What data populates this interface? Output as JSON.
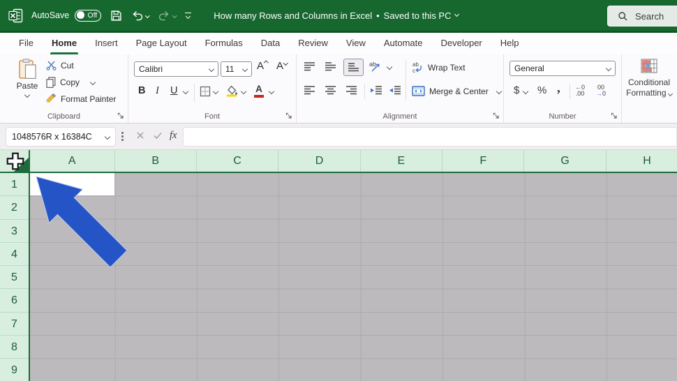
{
  "titlebar": {
    "autosave_label": "AutoSave",
    "autosave_state": "Off",
    "document_title": "How many Rows and Columns in Excel",
    "separator": "•",
    "save_status": "Saved to this PC",
    "search_label": "Search"
  },
  "tabs": [
    {
      "label": "File",
      "active": false
    },
    {
      "label": "Home",
      "active": true
    },
    {
      "label": "Insert",
      "active": false
    },
    {
      "label": "Page Layout",
      "active": false
    },
    {
      "label": "Formulas",
      "active": false
    },
    {
      "label": "Data",
      "active": false
    },
    {
      "label": "Review",
      "active": false
    },
    {
      "label": "View",
      "active": false
    },
    {
      "label": "Automate",
      "active": false
    },
    {
      "label": "Developer",
      "active": false
    },
    {
      "label": "Help",
      "active": false
    }
  ],
  "ribbon": {
    "clipboard": {
      "group_label": "Clipboard",
      "paste_label": "Paste",
      "cut_label": "Cut",
      "copy_label": "Copy",
      "format_painter_label": "Format Painter"
    },
    "font": {
      "group_label": "Font",
      "font_name": "Calibri",
      "font_size": "11",
      "grow_font_label": "A",
      "shrink_font_label": "A",
      "bold_label": "B",
      "italic_label": "I",
      "underline_label": "U",
      "font_color_letter": "A"
    },
    "alignment": {
      "group_label": "Alignment",
      "wrap_text_label": "Wrap Text",
      "merge_center_label": "Merge & Center",
      "orientation_glyph": "ab",
      "wrap_glyph_top": "ab",
      "wrap_glyph_bottom": "c"
    },
    "number": {
      "group_label": "Number",
      "number_format": "General",
      "currency_label": "$",
      "percent_label": "%",
      "comma_label": ",",
      "decimal_increase": {
        "arrow": "←",
        "top": "0",
        "bottom": ".00"
      },
      "decimal_decrease": {
        "top": "00",
        "arrow": "→",
        "bottom": "0"
      }
    },
    "styles": {
      "conditional_formatting_line1": "Conditional",
      "conditional_formatting_line2": "Formatting"
    }
  },
  "formula_bar": {
    "name_box_value": "1048576R x 16384C",
    "fx_label": "fx",
    "formula_value": ""
  },
  "grid": {
    "column_headers": [
      "A",
      "B",
      "C",
      "D",
      "E",
      "F",
      "G",
      "H"
    ],
    "row_headers": [
      "1",
      "2",
      "3",
      "4",
      "5",
      "6",
      "7",
      "8",
      "9"
    ],
    "active_cell": "A1"
  },
  "colors": {
    "titlebar_green": "#16682f",
    "tab_underline_green": "#1a7242",
    "header_fill_green": "#d8eede",
    "header_text_green": "#1d5c38",
    "selection_border_green": "#1d6b3c",
    "selected_cells_gray": "#bdbabd",
    "gridline_gray": "#adaaad",
    "arrow_blue": "#2554c7"
  }
}
